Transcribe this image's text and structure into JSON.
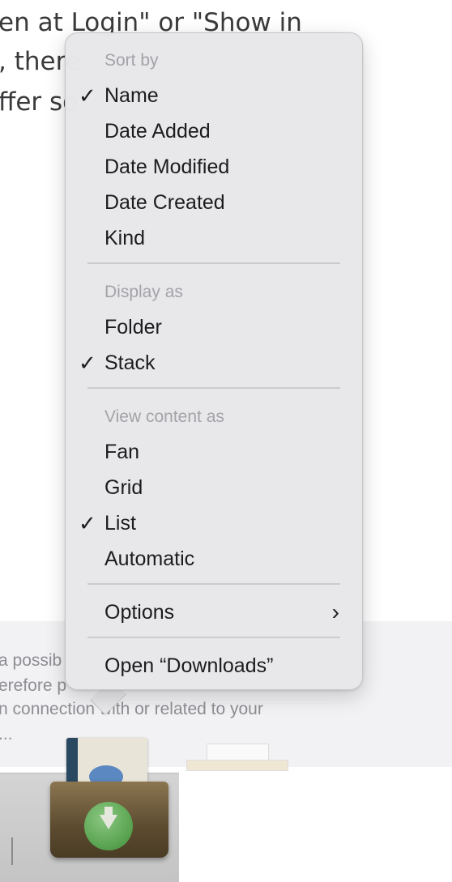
{
  "background": {
    "text_lines": [
      "en at Login\" or \"Show in",
      ", there",
      "ffer so"
    ],
    "disclaimer_lines": [
      "a possib",
      "erefore p",
      "n connection with or related to your",
      "..."
    ]
  },
  "menu": {
    "sections": [
      {
        "header": "Sort by",
        "items": [
          {
            "label": "Name",
            "checked": true
          },
          {
            "label": "Date Added",
            "checked": false
          },
          {
            "label": "Date Modified",
            "checked": false
          },
          {
            "label": "Date Created",
            "checked": false
          },
          {
            "label": "Kind",
            "checked": false
          }
        ]
      },
      {
        "header": "Display as",
        "items": [
          {
            "label": "Folder",
            "checked": false
          },
          {
            "label": "Stack",
            "checked": true
          }
        ]
      },
      {
        "header": "View content as",
        "items": [
          {
            "label": "Fan",
            "checked": false
          },
          {
            "label": "Grid",
            "checked": false
          },
          {
            "label": "List",
            "checked": true
          },
          {
            "label": "Automatic",
            "checked": false
          }
        ]
      }
    ],
    "options_label": "Options",
    "open_label": "Open “Downloads”",
    "check_glyph": "✓",
    "submenu_glyph": "›"
  },
  "dock": {
    "item_icon": "downloads-stack-icon"
  }
}
